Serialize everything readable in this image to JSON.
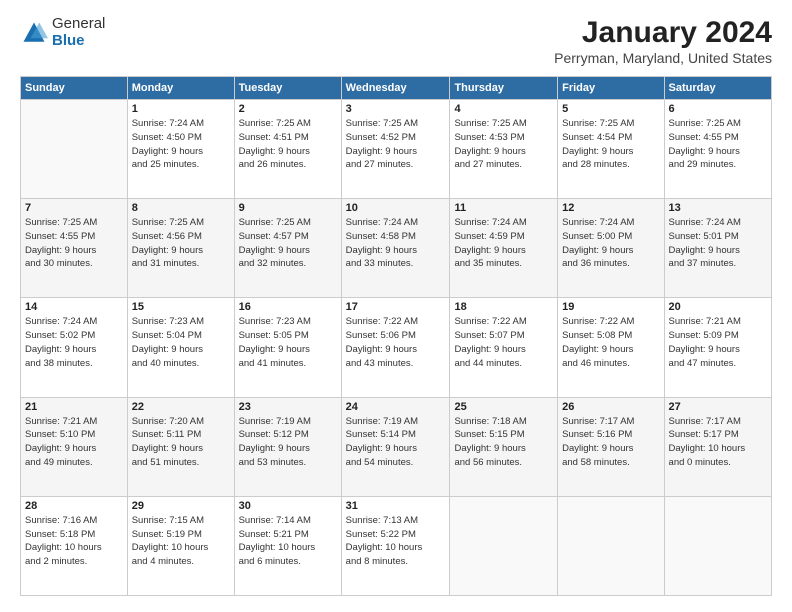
{
  "logo": {
    "general": "General",
    "blue": "Blue"
  },
  "title": "January 2024",
  "subtitle": "Perryman, Maryland, United States",
  "days_header": [
    "Sunday",
    "Monday",
    "Tuesday",
    "Wednesday",
    "Thursday",
    "Friday",
    "Saturday"
  ],
  "weeks": [
    [
      {
        "day": "",
        "info": ""
      },
      {
        "day": "1",
        "info": "Sunrise: 7:24 AM\nSunset: 4:50 PM\nDaylight: 9 hours\nand 25 minutes."
      },
      {
        "day": "2",
        "info": "Sunrise: 7:25 AM\nSunset: 4:51 PM\nDaylight: 9 hours\nand 26 minutes."
      },
      {
        "day": "3",
        "info": "Sunrise: 7:25 AM\nSunset: 4:52 PM\nDaylight: 9 hours\nand 27 minutes."
      },
      {
        "day": "4",
        "info": "Sunrise: 7:25 AM\nSunset: 4:53 PM\nDaylight: 9 hours\nand 27 minutes."
      },
      {
        "day": "5",
        "info": "Sunrise: 7:25 AM\nSunset: 4:54 PM\nDaylight: 9 hours\nand 28 minutes."
      },
      {
        "day": "6",
        "info": "Sunrise: 7:25 AM\nSunset: 4:55 PM\nDaylight: 9 hours\nand 29 minutes."
      }
    ],
    [
      {
        "day": "7",
        "info": "Sunrise: 7:25 AM\nSunset: 4:55 PM\nDaylight: 9 hours\nand 30 minutes."
      },
      {
        "day": "8",
        "info": "Sunrise: 7:25 AM\nSunset: 4:56 PM\nDaylight: 9 hours\nand 31 minutes."
      },
      {
        "day": "9",
        "info": "Sunrise: 7:25 AM\nSunset: 4:57 PM\nDaylight: 9 hours\nand 32 minutes."
      },
      {
        "day": "10",
        "info": "Sunrise: 7:24 AM\nSunset: 4:58 PM\nDaylight: 9 hours\nand 33 minutes."
      },
      {
        "day": "11",
        "info": "Sunrise: 7:24 AM\nSunset: 4:59 PM\nDaylight: 9 hours\nand 35 minutes."
      },
      {
        "day": "12",
        "info": "Sunrise: 7:24 AM\nSunset: 5:00 PM\nDaylight: 9 hours\nand 36 minutes."
      },
      {
        "day": "13",
        "info": "Sunrise: 7:24 AM\nSunset: 5:01 PM\nDaylight: 9 hours\nand 37 minutes."
      }
    ],
    [
      {
        "day": "14",
        "info": "Sunrise: 7:24 AM\nSunset: 5:02 PM\nDaylight: 9 hours\nand 38 minutes."
      },
      {
        "day": "15",
        "info": "Sunrise: 7:23 AM\nSunset: 5:04 PM\nDaylight: 9 hours\nand 40 minutes."
      },
      {
        "day": "16",
        "info": "Sunrise: 7:23 AM\nSunset: 5:05 PM\nDaylight: 9 hours\nand 41 minutes."
      },
      {
        "day": "17",
        "info": "Sunrise: 7:22 AM\nSunset: 5:06 PM\nDaylight: 9 hours\nand 43 minutes."
      },
      {
        "day": "18",
        "info": "Sunrise: 7:22 AM\nSunset: 5:07 PM\nDaylight: 9 hours\nand 44 minutes."
      },
      {
        "day": "19",
        "info": "Sunrise: 7:22 AM\nSunset: 5:08 PM\nDaylight: 9 hours\nand 46 minutes."
      },
      {
        "day": "20",
        "info": "Sunrise: 7:21 AM\nSunset: 5:09 PM\nDaylight: 9 hours\nand 47 minutes."
      }
    ],
    [
      {
        "day": "21",
        "info": "Sunrise: 7:21 AM\nSunset: 5:10 PM\nDaylight: 9 hours\nand 49 minutes."
      },
      {
        "day": "22",
        "info": "Sunrise: 7:20 AM\nSunset: 5:11 PM\nDaylight: 9 hours\nand 51 minutes."
      },
      {
        "day": "23",
        "info": "Sunrise: 7:19 AM\nSunset: 5:12 PM\nDaylight: 9 hours\nand 53 minutes."
      },
      {
        "day": "24",
        "info": "Sunrise: 7:19 AM\nSunset: 5:14 PM\nDaylight: 9 hours\nand 54 minutes."
      },
      {
        "day": "25",
        "info": "Sunrise: 7:18 AM\nSunset: 5:15 PM\nDaylight: 9 hours\nand 56 minutes."
      },
      {
        "day": "26",
        "info": "Sunrise: 7:17 AM\nSunset: 5:16 PM\nDaylight: 9 hours\nand 58 minutes."
      },
      {
        "day": "27",
        "info": "Sunrise: 7:17 AM\nSunset: 5:17 PM\nDaylight: 10 hours\nand 0 minutes."
      }
    ],
    [
      {
        "day": "28",
        "info": "Sunrise: 7:16 AM\nSunset: 5:18 PM\nDaylight: 10 hours\nand 2 minutes."
      },
      {
        "day": "29",
        "info": "Sunrise: 7:15 AM\nSunset: 5:19 PM\nDaylight: 10 hours\nand 4 minutes."
      },
      {
        "day": "30",
        "info": "Sunrise: 7:14 AM\nSunset: 5:21 PM\nDaylight: 10 hours\nand 6 minutes."
      },
      {
        "day": "31",
        "info": "Sunrise: 7:13 AM\nSunset: 5:22 PM\nDaylight: 10 hours\nand 8 minutes."
      },
      {
        "day": "",
        "info": ""
      },
      {
        "day": "",
        "info": ""
      },
      {
        "day": "",
        "info": ""
      }
    ]
  ]
}
